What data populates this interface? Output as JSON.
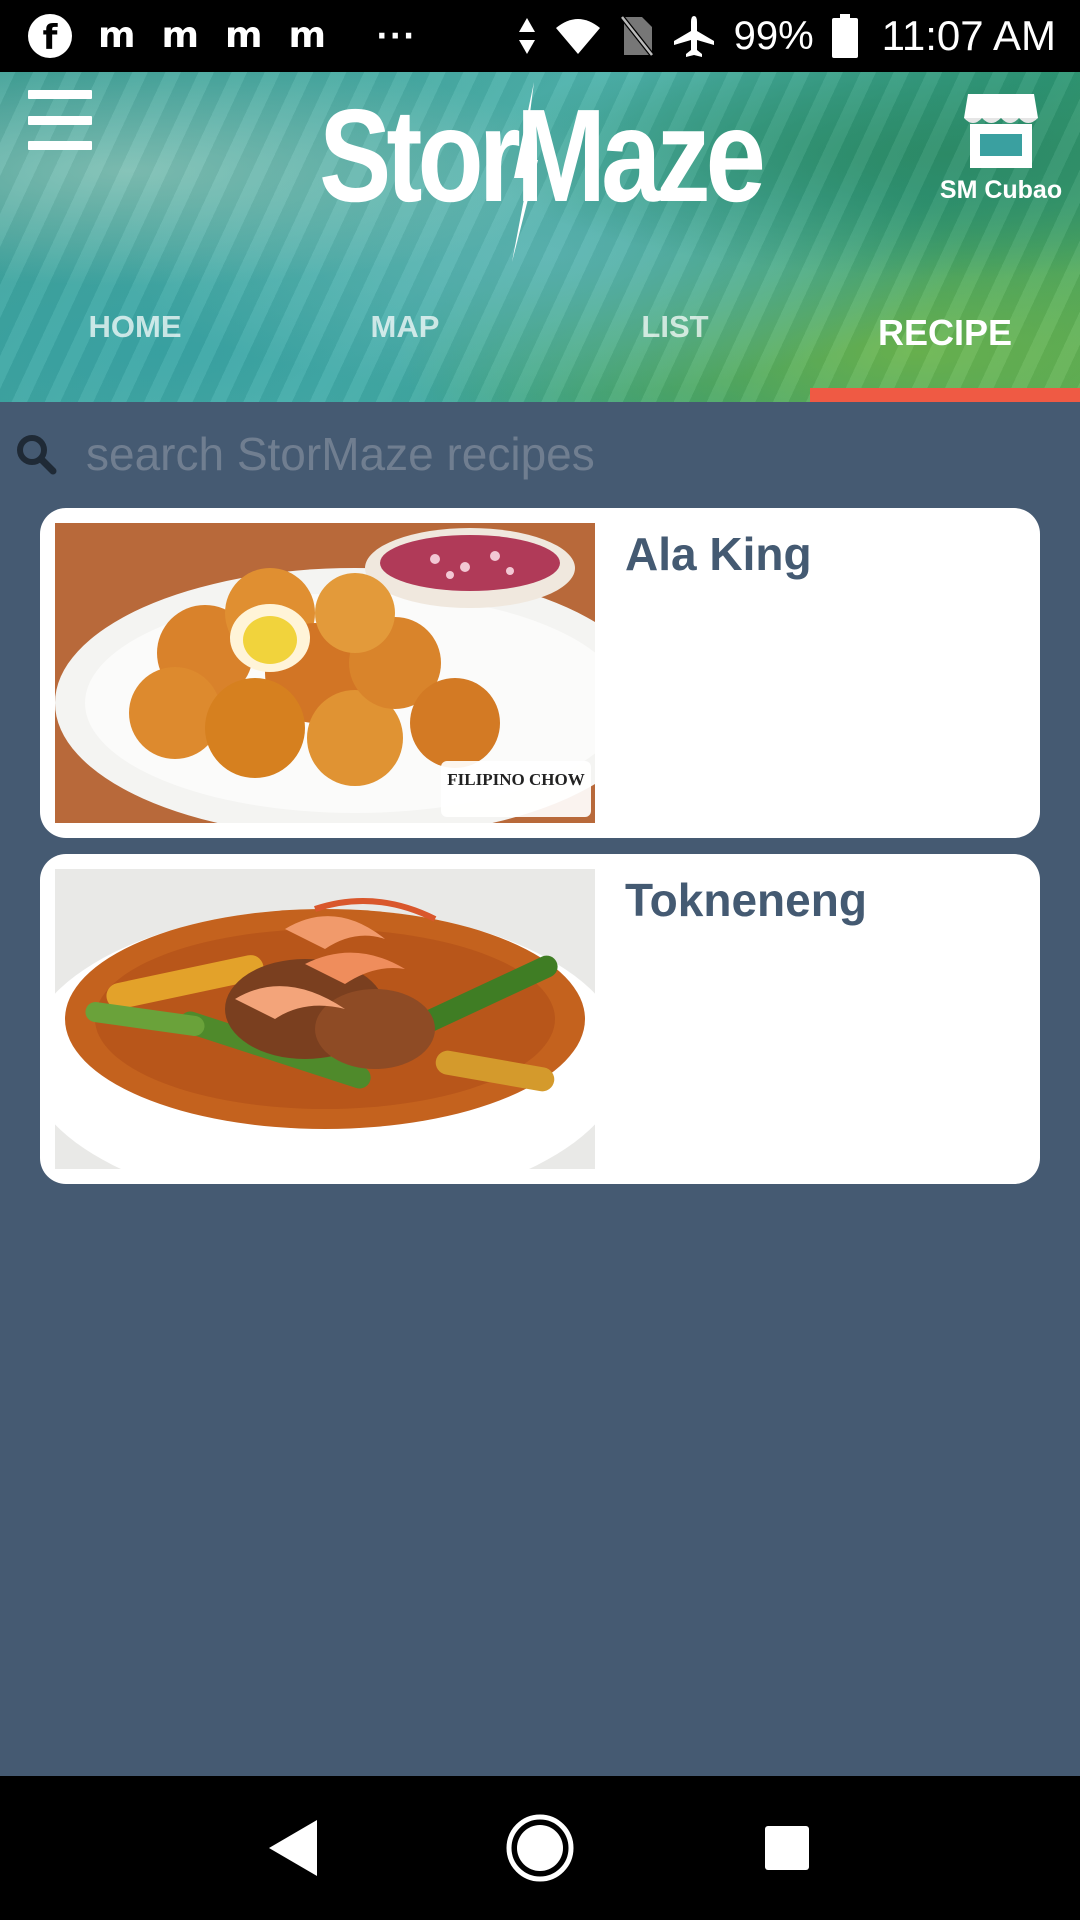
{
  "status_bar": {
    "notification_icons": [
      "facebook-icon",
      "m-icon",
      "m-icon",
      "m-icon",
      "m-icon"
    ],
    "overflow": "···",
    "battery": "99%",
    "time": "11:07 AM"
  },
  "header": {
    "app_name": "StorMaze",
    "store_name": "SM Cubao",
    "tabs": [
      {
        "label": "HOME"
      },
      {
        "label": "MAP"
      },
      {
        "label": "LIST"
      },
      {
        "label": "RECIPE"
      }
    ],
    "active_tab": "RECIPE",
    "accent_color": "#ef5a44"
  },
  "search": {
    "placeholder": "search StorMaze recipes",
    "value": ""
  },
  "recipes": [
    {
      "title": "Ala King",
      "image": "fried-egg-balls-dish-photo",
      "watermark": "FILIPINO CHOW"
    },
    {
      "title": "Tokneneng",
      "image": "shrimp-vegetable-stew-photo"
    }
  ],
  "colors": {
    "background": "#455a72",
    "card_title": "#445a72",
    "card_background": "#ffffff"
  }
}
